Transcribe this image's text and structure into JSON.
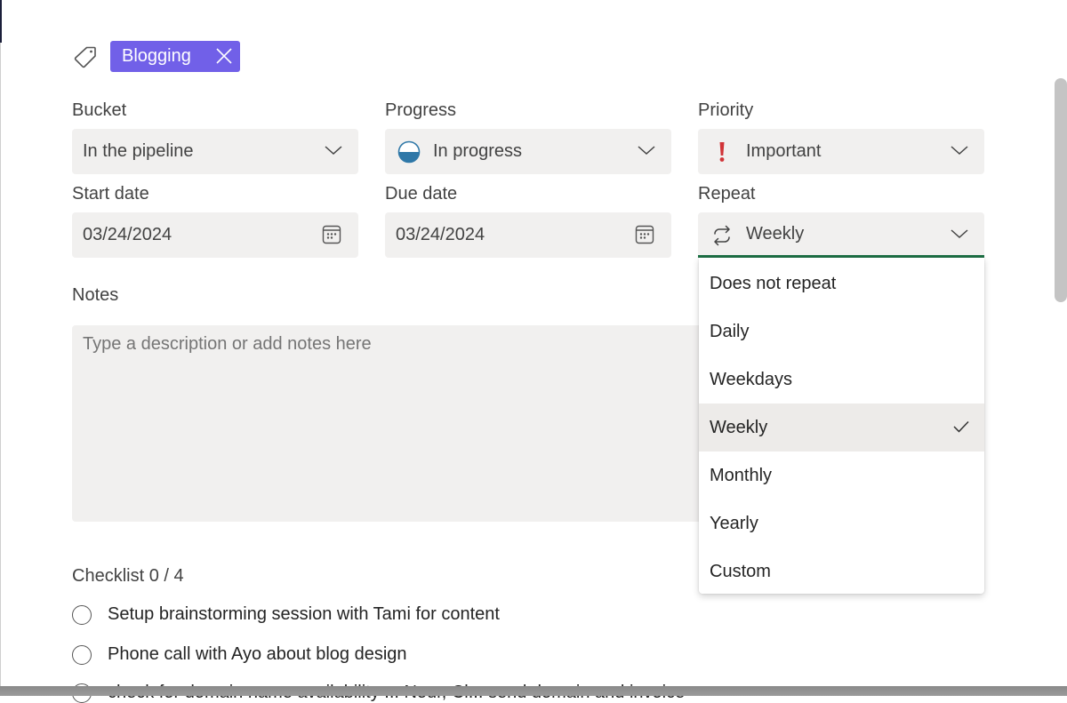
{
  "labels": {
    "chip_text": "Blogging",
    "chip_color": "#7160e8"
  },
  "fields": {
    "bucket": {
      "label": "Bucket",
      "value": "In the pipeline"
    },
    "progress": {
      "label": "Progress",
      "value": "In progress",
      "icon": "half-circle-progress-icon"
    },
    "priority": {
      "label": "Priority",
      "value": "Important",
      "icon": "exclamation-icon",
      "icon_color": "#d13438"
    },
    "start_date": {
      "label": "Start date",
      "value": "03/24/2024"
    },
    "due_date": {
      "label": "Due date",
      "value": "03/24/2024"
    },
    "repeat": {
      "label": "Repeat",
      "value": "Weekly",
      "icon": "repeat-icon",
      "accent": "#1e7145"
    }
  },
  "notes": {
    "label": "Notes",
    "placeholder": "Type a description or add notes here"
  },
  "checklist": {
    "title": "Checklist 0 / 4",
    "items": [
      {
        "text": "Setup brainstorming session with Tami for content"
      },
      {
        "text": "Phone call with Ayo about blog design"
      },
      {
        "text": "check for domain name availability ... Nour, Cl... send domain and invoice"
      }
    ]
  },
  "repeat_menu": {
    "options": [
      {
        "label": "Does not repeat",
        "selected": false
      },
      {
        "label": "Daily",
        "selected": false
      },
      {
        "label": "Weekdays",
        "selected": false
      },
      {
        "label": "Weekly",
        "selected": true
      },
      {
        "label": "Monthly",
        "selected": false
      },
      {
        "label": "Yearly",
        "selected": false
      },
      {
        "label": "Custom",
        "selected": false
      }
    ]
  }
}
